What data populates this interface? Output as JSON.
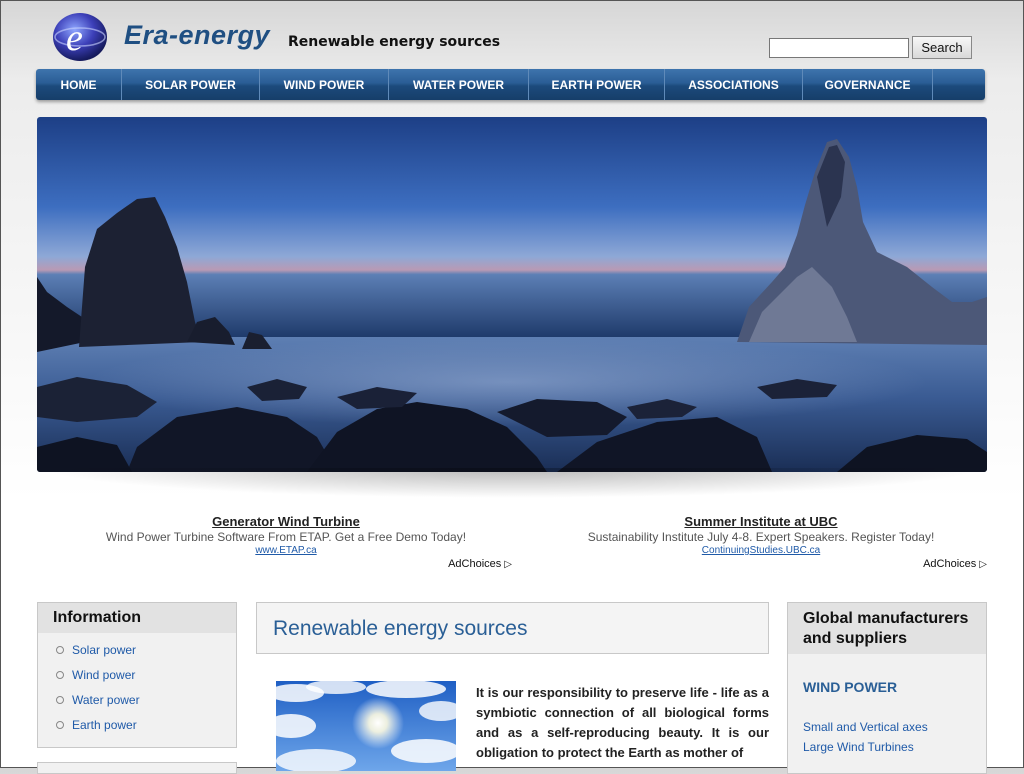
{
  "header": {
    "brand": "Era-energy",
    "tagline": "Renewable energy sources",
    "logo_letter": "e",
    "search": {
      "value": "",
      "button_label": "Search"
    }
  },
  "nav": {
    "items": [
      {
        "label": "HOME"
      },
      {
        "label": "SOLAR POWER"
      },
      {
        "label": "WIND POWER"
      },
      {
        "label": "WATER POWER"
      },
      {
        "label": "EARTH POWER"
      },
      {
        "label": "ASSOCIATIONS"
      },
      {
        "label": "GOVERNANCE"
      }
    ]
  },
  "ads": [
    {
      "title": "Generator Wind Turbine",
      "text": "Wind Power Turbine Software From ETAP. Get a Free Demo Today!",
      "url": "www.ETAP.ca",
      "choices": "AdChoices"
    },
    {
      "title": "Summer Institute at UBC",
      "text": "Sustainability Institute July 4-8. Expert Speakers. Register Today!",
      "url": "ContinuingStudies.UBC.ca",
      "choices": "AdChoices"
    }
  ],
  "sidebar": {
    "title": "Information",
    "items": [
      {
        "label": "Solar power"
      },
      {
        "label": "Wind power"
      },
      {
        "label": "Water power"
      },
      {
        "label": "Earth power"
      }
    ]
  },
  "main": {
    "title": "Renewable energy sources",
    "body": "It is our responsibility to preserve life - life as a symbiotic connection of all biological forms and as a self-reproducing beauty. It is our obligation to protect the Earth as mother of"
  },
  "right": {
    "title": "Global manufacturers and suppliers",
    "section": "WIND POWER",
    "links": [
      {
        "label": "Small and Vertical axes"
      },
      {
        "label": "Large Wind Turbines"
      }
    ]
  },
  "colors": {
    "nav": "#2a5d95",
    "brand": "#1f4f82",
    "link": "#1f5aa8",
    "heading": "#2a5f96"
  }
}
